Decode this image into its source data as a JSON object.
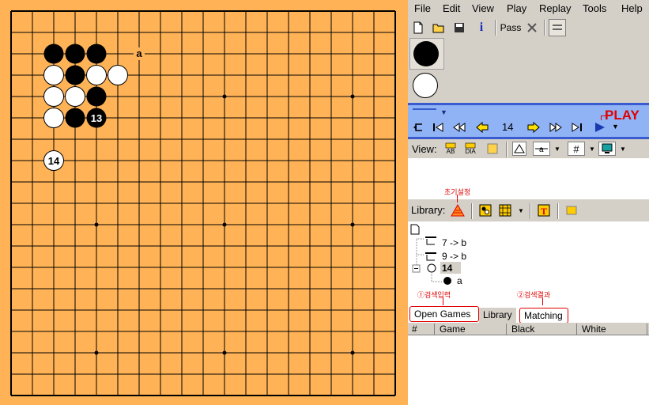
{
  "menu": [
    "File",
    "Edit",
    "View",
    "Play",
    "Replay",
    "Tools",
    "Help"
  ],
  "toolbar": {
    "pass_label": "Pass"
  },
  "nav": {
    "move_number": "14",
    "play_label": "PLAY"
  },
  "view": {
    "label": "View:",
    "icon_texts": [
      "AB",
      "DIA"
    ]
  },
  "library": {
    "label": "Library:",
    "note_top": "초기설정"
  },
  "tree": {
    "lines": [
      "7 -> b",
      "9 -> b",
      "14",
      "a"
    ]
  },
  "tabs": {
    "open_games": "Open Games",
    "library": "Library",
    "matching": "Matching",
    "note1": "①검색입력",
    "note2": "②검색결과"
  },
  "grid": {
    "columns": [
      "#",
      "Game",
      "Black",
      "White"
    ]
  },
  "board": {
    "size": 19,
    "black_stones": [
      [
        2,
        2
      ],
      [
        3,
        2
      ],
      [
        4,
        2
      ],
      [
        3,
        3
      ],
      [
        4,
        4
      ],
      [
        3,
        5
      ]
    ],
    "white_stones": [
      [
        2,
        3
      ],
      [
        4,
        3
      ],
      [
        5,
        3
      ],
      [
        2,
        4
      ],
      [
        3,
        4
      ],
      [
        2,
        5
      ]
    ],
    "numbered_black": [
      {
        "col": 4,
        "row": 5,
        "label": "13"
      }
    ],
    "numbered_white": [
      {
        "col": 2,
        "row": 7,
        "label": "14"
      }
    ],
    "markers": [
      {
        "col": 6,
        "row": 2,
        "label": "a"
      }
    ],
    "hoshi": [
      [
        4,
        4
      ],
      [
        10,
        4
      ],
      [
        16,
        4
      ],
      [
        4,
        10
      ],
      [
        10,
        10
      ],
      [
        16,
        10
      ],
      [
        4,
        16
      ],
      [
        10,
        16
      ],
      [
        16,
        16
      ]
    ]
  }
}
